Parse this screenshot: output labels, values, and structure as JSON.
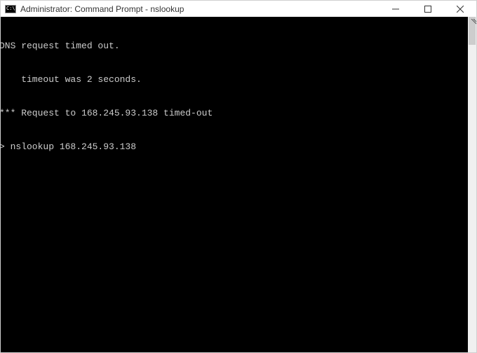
{
  "titlebar": {
    "icon_text": "C:\\",
    "title": "Administrator: Command Prompt - nslookup"
  },
  "window_controls": {
    "minimize": "Minimize",
    "maximize": "Maximize",
    "close": "Close"
  },
  "terminal": {
    "lines": [
      "DNS request timed out.",
      "    timeout was 2 seconds.",
      "*** Request to 168.245.93.138 timed-out",
      "> nslookup 168.245.93.138"
    ]
  }
}
